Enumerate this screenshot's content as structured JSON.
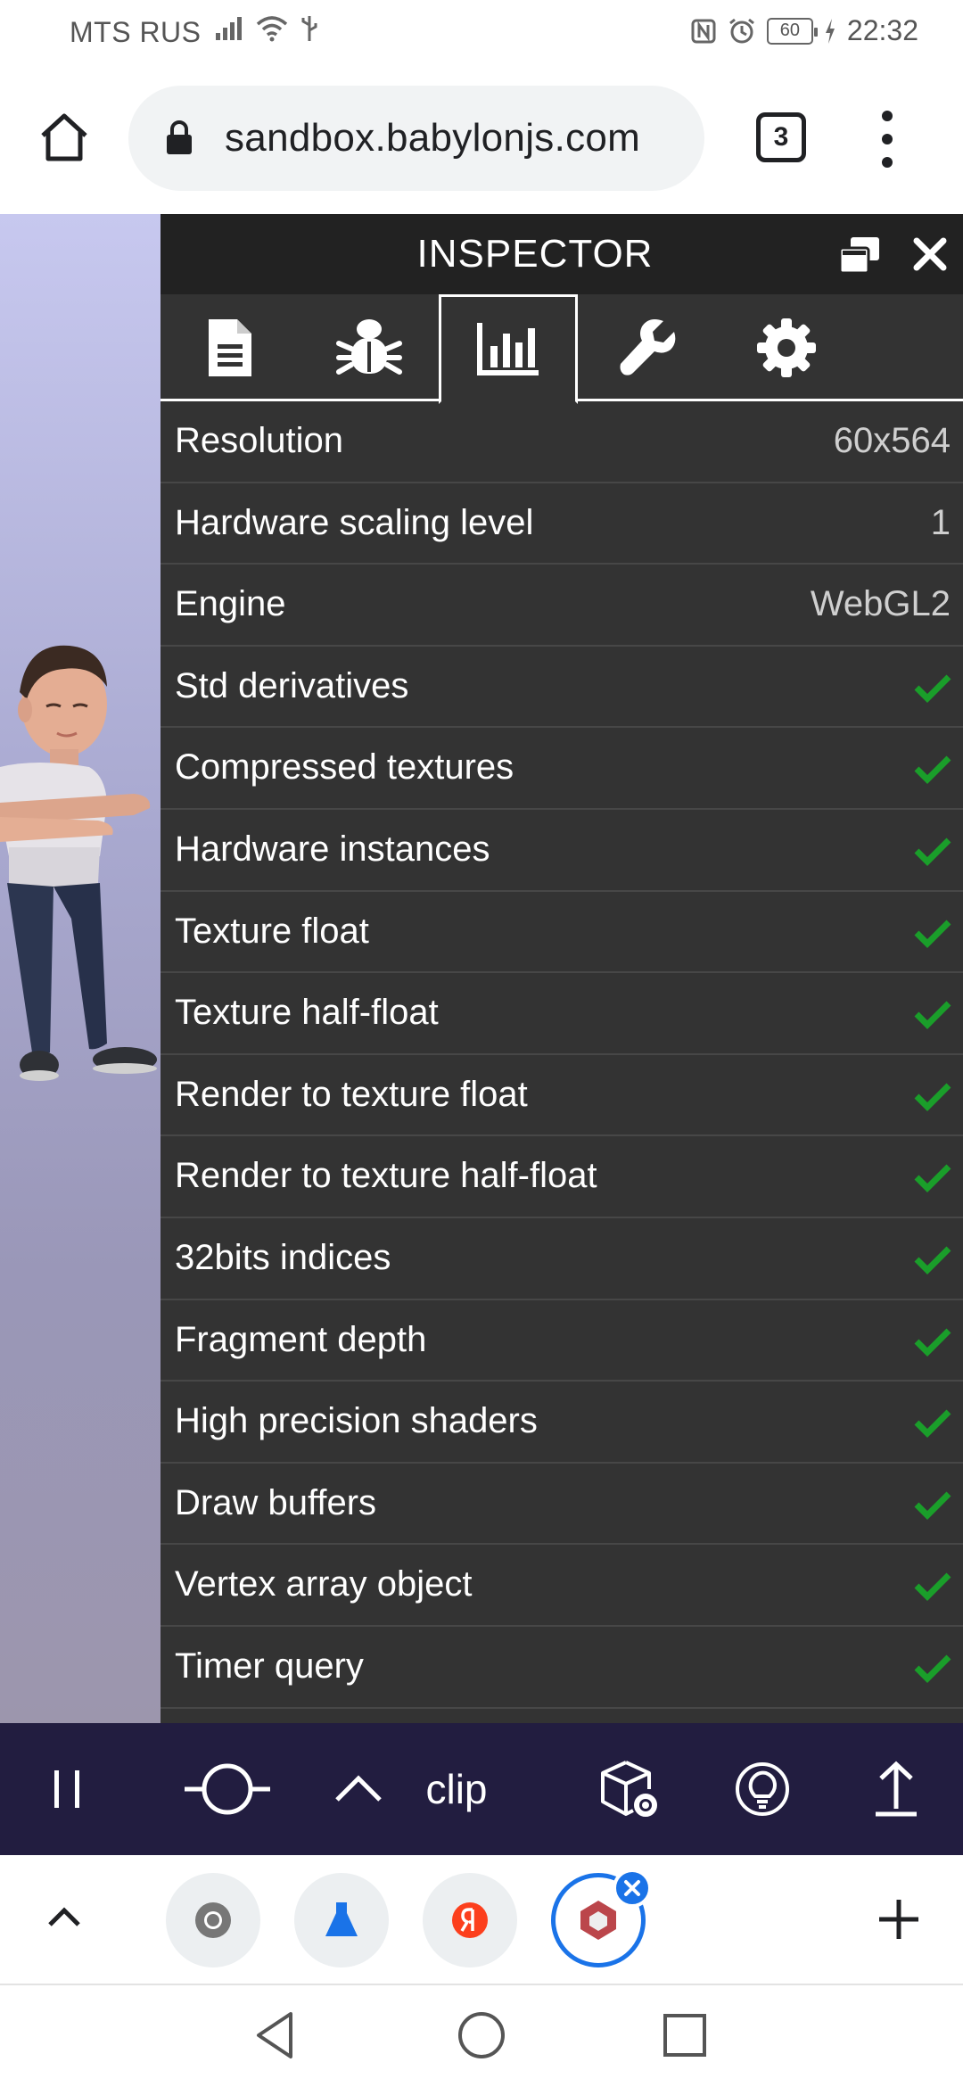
{
  "status_bar": {
    "carrier": "MTS RUS",
    "battery": "60",
    "time": "22:32"
  },
  "browser": {
    "url": "sandbox.babylonjs.com",
    "tab_count": "3",
    "icons": [
      "home-icon",
      "lock-icon",
      "tab-switcher-icon",
      "more-vert-icon"
    ]
  },
  "inspector": {
    "title": "INSPECTOR",
    "tabs": [
      "document-icon",
      "bug-icon",
      "statistics-icon",
      "wrench-icon",
      "gear-icon"
    ],
    "active_tab": 2,
    "rows": [
      {
        "label": "Resolution",
        "value": "60x564"
      },
      {
        "label": "Hardware scaling level",
        "value": "1"
      },
      {
        "label": "Engine",
        "value": "WebGL2"
      },
      {
        "label": "Std derivatives",
        "check": true
      },
      {
        "label": "Compressed textures",
        "check": true
      },
      {
        "label": "Hardware instances",
        "check": true
      },
      {
        "label": "Texture float",
        "check": true
      },
      {
        "label": "Texture half-float",
        "check": true
      },
      {
        "label": "Render to texture float",
        "check": true
      },
      {
        "label": "Render to texture half-float",
        "check": true
      },
      {
        "label": "32bits indices",
        "check": true
      },
      {
        "label": "Fragment depth",
        "check": true
      },
      {
        "label": "High precision shaders",
        "check": true
      },
      {
        "label": "Draw buffers",
        "check": true
      },
      {
        "label": "Vertex array object",
        "check": true
      },
      {
        "label": "Timer query",
        "check": true
      }
    ],
    "colors": {
      "header": "#222222",
      "panel": "#333333",
      "check": "#1a9e2a"
    }
  },
  "toolbar": {
    "animation_name": "clip",
    "icons": [
      "pause-icon",
      "timeline-icon",
      "chevron-up-icon",
      "cube-settings-icon",
      "lightbulb-icon",
      "upload-icon"
    ],
    "color": "#221d40"
  },
  "tab_strip": {
    "icons": [
      "chevron-up-icon",
      "chrome-icon",
      "flask-icon",
      "yandex-icon",
      "babylon-icon",
      "plus-icon"
    ]
  },
  "nav": {
    "icons": [
      "back-icon",
      "home-icon",
      "recents-icon"
    ]
  }
}
